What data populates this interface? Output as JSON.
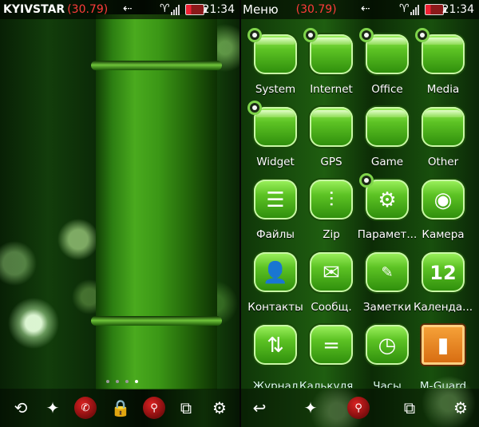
{
  "home": {
    "carrier": "KYIVSTAR",
    "credit": "(30.79)",
    "time": "21:34",
    "dock": {
      "left_icon": "contacts-sync-icon",
      "apps_icon": "apps-icon",
      "call_icon": "phone-icon",
      "lock_icon": "lock-icon",
      "search_icon": "search-icon",
      "tasks_icon": "task-switcher-icon",
      "settings_icon": "gear-icon"
    }
  },
  "menu": {
    "title": "Меню",
    "credit": "(30.79)",
    "time": "21:34",
    "items": [
      {
        "label": "System"
      },
      {
        "label": "Internet"
      },
      {
        "label": "Office"
      },
      {
        "label": "Media"
      },
      {
        "label": "Widget"
      },
      {
        "label": "GPS"
      },
      {
        "label": "Game"
      },
      {
        "label": "Other"
      },
      {
        "label": "Файлы"
      },
      {
        "label": "Zip"
      },
      {
        "label": "Парамет..."
      },
      {
        "label": "Камера"
      },
      {
        "label": "Контакты"
      },
      {
        "label": "Сообщ."
      },
      {
        "label": "Заметки"
      },
      {
        "label": "Календа..."
      },
      {
        "label": "Журнал"
      },
      {
        "label": "Калькуля..."
      },
      {
        "label": "Часы"
      },
      {
        "label": "M-Guard"
      }
    ],
    "calendar_day": "12",
    "dock": {
      "back_icon": "back-icon",
      "apps_icon": "apps-icon",
      "search_icon": "search-icon",
      "tasks_icon": "task-switcher-icon",
      "settings_icon": "gear-icon"
    }
  },
  "colors": {
    "accent_green": "#5dc324",
    "credit_red": "#ff3b3b"
  }
}
